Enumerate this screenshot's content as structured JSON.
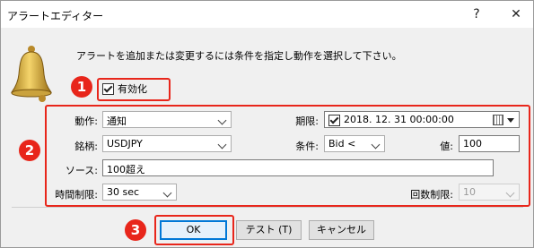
{
  "window": {
    "title": "アラートエディター",
    "help": "?",
    "close": "✕"
  },
  "instruction": "アラートを追加または変更するには条件を指定し動作を選択して下さい。",
  "enable": {
    "label": "有効化",
    "checked": true
  },
  "fields": {
    "action": {
      "label": "動作:",
      "value": "通知"
    },
    "expiry": {
      "label": "期限:",
      "value": "2018. 12. 31 00:00:00",
      "checked": true
    },
    "symbol": {
      "label": "銘柄:",
      "value": "USDJPY"
    },
    "condition": {
      "label": "条件:",
      "value": "Bid <"
    },
    "threshold": {
      "label": "値:",
      "value": "100"
    },
    "source": {
      "label": "ソース:",
      "value": "100超え"
    },
    "timeout": {
      "label": "時間制限:",
      "value": "30 sec"
    },
    "count": {
      "label": "回数制限:",
      "value": "10"
    }
  },
  "buttons": {
    "ok": "OK",
    "test": "テスト (T)",
    "cancel": "キャンセル"
  },
  "badges": [
    "1",
    "2",
    "3"
  ],
  "colors": {
    "highlight": "#e8261b",
    "badge_text": "#ffffff"
  }
}
